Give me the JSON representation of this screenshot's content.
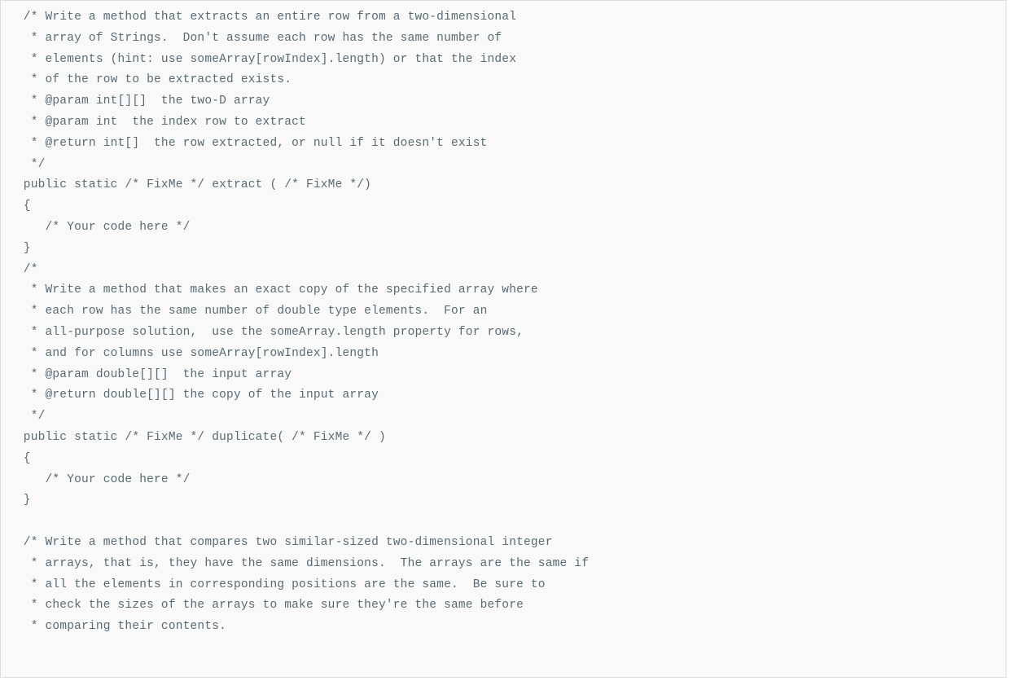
{
  "code": {
    "lines": [
      "  /* Write a method that extracts an entire row from a two-dimensional",
      "   * array of Strings.  Don't assume each row has the same number of",
      "   * elements (hint: use someArray[rowIndex].length) or that the index",
      "   * of the row to be extracted exists.",
      "   * @param int[][]  the two-D array",
      "   * @param int  the index row to extract",
      "   * @return int[]  the row extracted, or null if it doesn't exist",
      "   */",
      "  public static /* FixMe */ extract ( /* FixMe */)",
      "  {",
      "     /* Your code here */",
      "  }",
      "  /*",
      "   * Write a method that makes an exact copy of the specified array where",
      "   * each row has the same number of double type elements.  For an",
      "   * all-purpose solution,  use the someArray.length property for rows,",
      "   * and for columns use someArray[rowIndex].length",
      "   * @param double[][]  the input array",
      "   * @return double[][] the copy of the input array",
      "   */",
      "  public static /* FixMe */ duplicate( /* FixMe */ )",
      "  {",
      "     /* Your code here */",
      "  }",
      "",
      "  /* Write a method that compares two similar-sized two-dimensional integer",
      "   * arrays, that is, they have the same dimensions.  The arrays are the same if",
      "   * all the elements in corresponding positions are the same.  Be sure to",
      "   * check the sizes of the arrays to make sure they're the same before",
      "   * comparing their contents."
    ]
  }
}
